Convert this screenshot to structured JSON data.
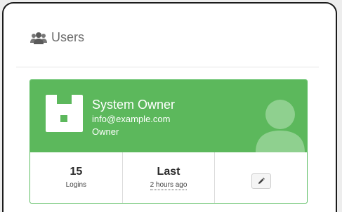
{
  "panel": {
    "title": "Users",
    "icon": "users-icon"
  },
  "user_card": {
    "name": "System Owner",
    "email": "info@example.com",
    "role": "Owner",
    "org_icon": "organization-icon",
    "avatar_icon": "user-silhouette-icon",
    "stats": {
      "logins_value": "15",
      "logins_label": "Logins",
      "last_value": "Last",
      "last_label": "2 hours ago"
    },
    "edit_icon": "pencil-icon"
  },
  "colors": {
    "card_accent": "#5cb85c",
    "card_border": "#5bbd62",
    "title_text": "#6b6b6b"
  }
}
